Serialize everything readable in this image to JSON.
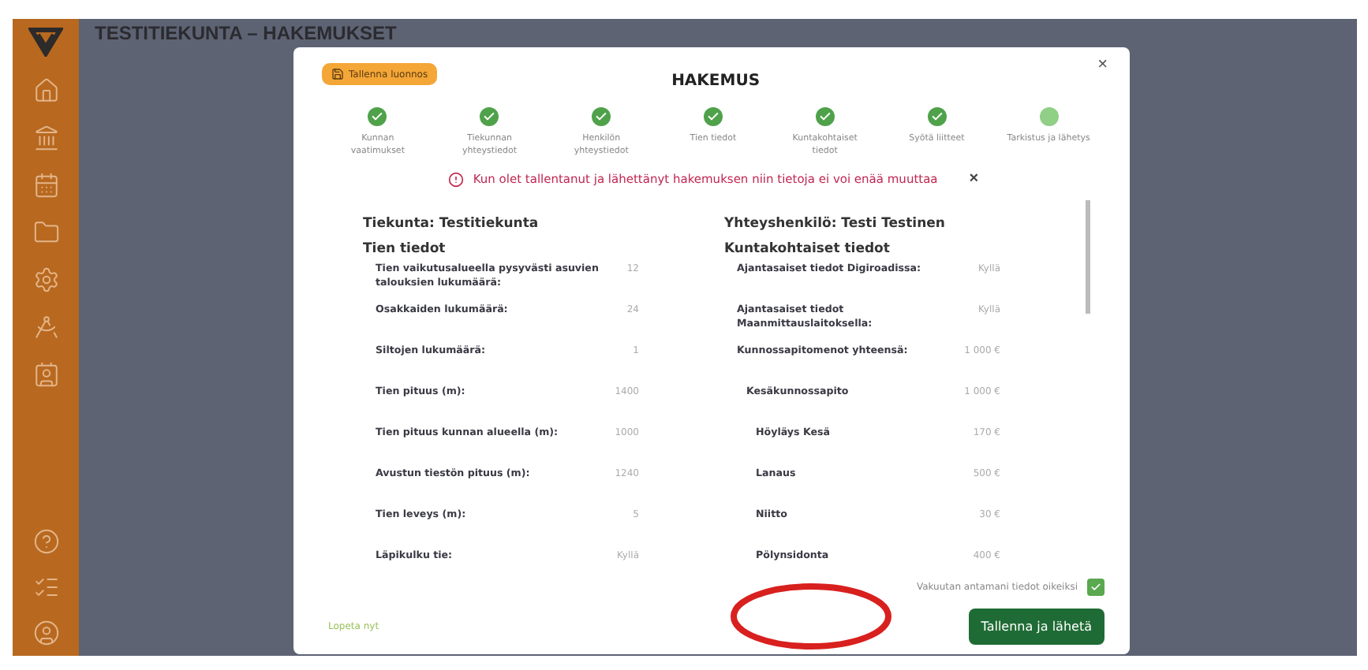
{
  "header": {
    "title": "TESTITIEKUNTA – HAKEMUKSET"
  },
  "sidebar": {
    "items": [
      {
        "kind": "home"
      },
      {
        "kind": "bank"
      },
      {
        "kind": "calendar"
      },
      {
        "kind": "folder"
      },
      {
        "kind": "gear"
      },
      {
        "kind": "compass"
      },
      {
        "kind": "contact"
      }
    ],
    "bottom_items": [
      {
        "kind": "help"
      },
      {
        "kind": "checklist"
      },
      {
        "kind": "user"
      }
    ]
  },
  "modal": {
    "draft_button": "Tallenna luonnos",
    "title": "HAKEMUS",
    "close": "×",
    "steps": [
      {
        "label": "Kunnan vaatimukset",
        "completed": true
      },
      {
        "label": "Tiekunnan yhteystiedot",
        "completed": true
      },
      {
        "label": "Henkilön yhteystiedot",
        "completed": true
      },
      {
        "label": "Tien tiedot",
        "completed": true
      },
      {
        "label": "Kuntakohtaiset tiedot",
        "completed": true
      },
      {
        "label": "Syötä liitteet",
        "completed": true
      },
      {
        "label": "Tarkistus ja lähetys",
        "completed": false
      }
    ],
    "alert": {
      "text": "Kun olet tallentanut ja lähettänyt hakemuksen niin tietoja ei voi enää muuttaa",
      "close": "×"
    },
    "left": {
      "heading": "Tiekunta: Testitiekunta",
      "section": "Tien tiedot",
      "rows": [
        {
          "label": "Tien vaikutusalueella pysyvästi asuvien talouksien lukumäärä:",
          "value": "12"
        },
        {
          "label": "Osakkaiden lukumäärä:",
          "value": "24"
        },
        {
          "label": "Siltojen lukumäärä:",
          "value": "1"
        },
        {
          "label": "Tien pituus (m):",
          "value": "1400"
        },
        {
          "label": "Tien pituus kunnan alueella (m):",
          "value": "1000"
        },
        {
          "label": "Avustun tiestön pituus (m):",
          "value": "1240"
        },
        {
          "label": "Tien leveys (m):",
          "value": "5"
        },
        {
          "label": "Läpikulku tie:",
          "value": "Kyllä"
        }
      ]
    },
    "right": {
      "heading": "Yhteyshenkilö: Testi Testinen",
      "section": "Kuntakohtaiset tiedot",
      "rows": [
        {
          "label": "Ajantasaiset tiedot Digiroadissa:",
          "value": "Kyllä"
        },
        {
          "label": "Ajantasaiset tiedot Maanmittauslaitoksella:",
          "value": "Kyllä"
        },
        {
          "label": "Kunnossapitomenot yhteensä:",
          "value": "1 000 €",
          "children": [
            {
              "label": "Kesäkunnossapito",
              "value": "1 000 €",
              "children": [
                {
                  "label": "Höyläys Kesä",
                  "value": "170 €"
                },
                {
                  "label": "Lanaus",
                  "value": "500 €"
                },
                {
                  "label": "Niitto",
                  "value": "30 €"
                },
                {
                  "label": "Pölynsidonta",
                  "value": "400 €"
                }
              ]
            }
          ]
        }
      ]
    },
    "confirm": {
      "label": "Vakuutan antamani tiedot oikeiksi",
      "checked": true
    },
    "back_link": "Lopeta nyt",
    "submit_button": "Tallenna ja lähetä"
  }
}
